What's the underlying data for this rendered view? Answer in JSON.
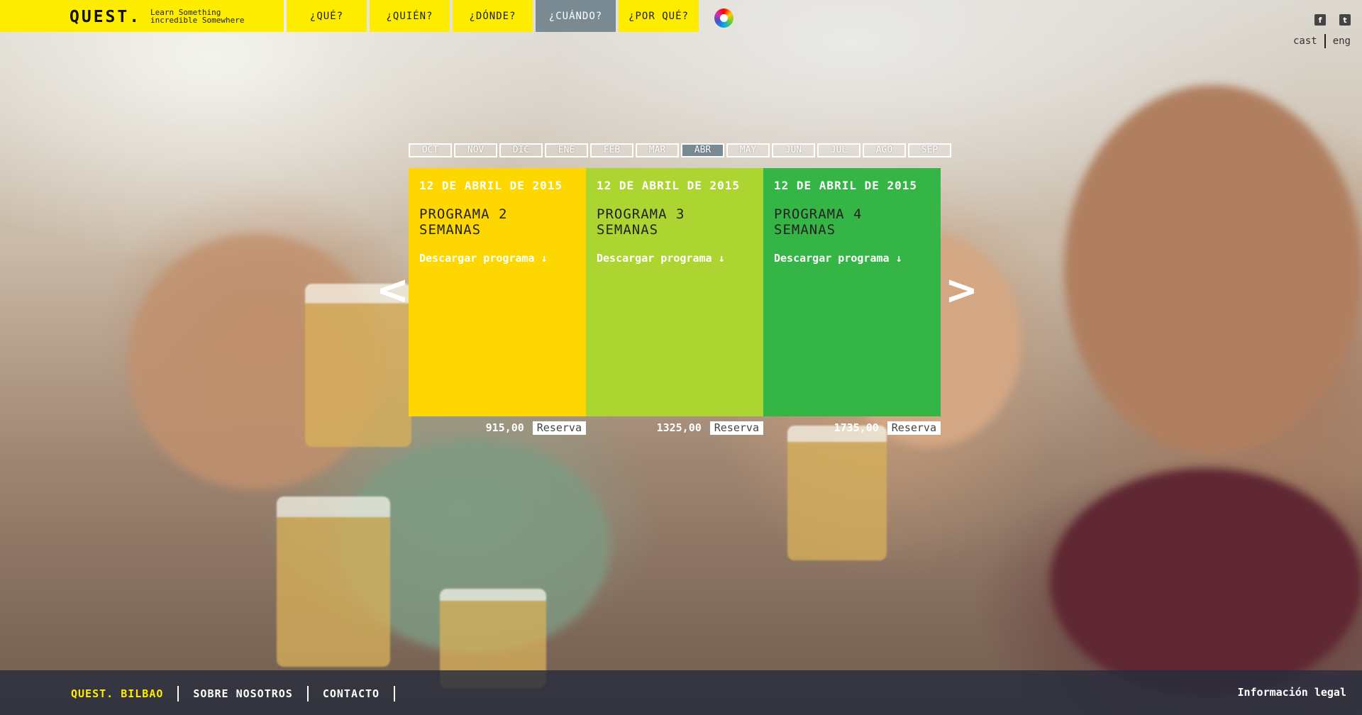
{
  "brand": {
    "logo": "QUEST.",
    "tagline_line1": "Learn Something",
    "tagline_line2": "incredible Somewhere"
  },
  "nav": [
    {
      "label": "¿QUÉ?",
      "active": false
    },
    {
      "label": "¿QUIÉN?",
      "active": false
    },
    {
      "label": "¿DÓNDE?",
      "active": false
    },
    {
      "label": "¿CUÁNDO?",
      "active": true
    },
    {
      "label": "¿POR QUÉ?",
      "active": false
    }
  ],
  "social": {
    "facebook": "f",
    "twitter": "t"
  },
  "lang": {
    "cast": "cast",
    "eng": "eng"
  },
  "months": [
    {
      "label": "OCT",
      "active": false
    },
    {
      "label": "NOV",
      "active": false
    },
    {
      "label": "DIC",
      "active": false
    },
    {
      "label": "ENE",
      "active": false
    },
    {
      "label": "FEB",
      "active": false
    },
    {
      "label": "MAR",
      "active": false
    },
    {
      "label": "ABR",
      "active": true
    },
    {
      "label": "MAY",
      "active": false
    },
    {
      "label": "JUN",
      "active": false
    },
    {
      "label": "JUL",
      "active": false
    },
    {
      "label": "AGO",
      "active": false
    },
    {
      "label": "SEP",
      "active": false
    }
  ],
  "programs": [
    {
      "date": "12 DE ABRIL DE 2015",
      "title": "PROGRAMA 2 SEMANAS",
      "download": "Descargar programa ↓",
      "price": "915,00",
      "reserve": "Reserva",
      "color": "#fed700"
    },
    {
      "date": "12 DE ABRIL DE 2015",
      "title": "PROGRAMA 3 SEMANAS",
      "download": "Descargar programa ↓",
      "price": "1325,00",
      "reserve": "Reserva",
      "color": "#acd531"
    },
    {
      "date": "12 DE ABRIL DE 2015",
      "title": "PROGRAMA 4 SEMANAS",
      "download": "Descargar programa ↓",
      "price": "1735,00",
      "reserve": "Reserva",
      "color": "#35b546"
    }
  ],
  "arrows": {
    "prev": "<",
    "next": ">"
  },
  "footer": {
    "brand": "QUEST. BILBAO",
    "about": "SOBRE NOSOTROS",
    "contact": "CONTACTO",
    "legal": "Información legal"
  }
}
